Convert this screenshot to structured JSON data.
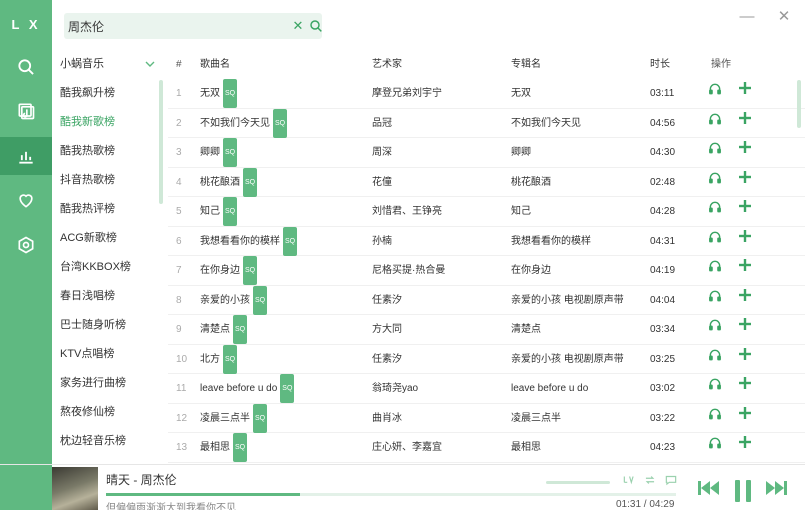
{
  "app": {
    "logo": "L X"
  },
  "search": {
    "value": "周杰伦",
    "clear_glyph": "✕"
  },
  "window": {
    "minimize": "—",
    "close": "✕"
  },
  "sources": {
    "selected": "小蜗音乐",
    "items": [
      {
        "label": "酷我飙升榜",
        "active": false
      },
      {
        "label": "酷我新歌榜",
        "active": true
      },
      {
        "label": "酷我热歌榜",
        "active": false
      },
      {
        "label": "抖音热歌榜",
        "active": false
      },
      {
        "label": "酷我热评榜",
        "active": false
      },
      {
        "label": "ACG新歌榜",
        "active": false
      },
      {
        "label": "台湾KKBOX榜",
        "active": false
      },
      {
        "label": "春日浅唱榜",
        "active": false
      },
      {
        "label": "巴士随身听榜",
        "active": false
      },
      {
        "label": "KTV点唱榜",
        "active": false
      },
      {
        "label": "家务进行曲榜",
        "active": false
      },
      {
        "label": "熬夜修仙榜",
        "active": false
      },
      {
        "label": "枕边轻音乐榜",
        "active": false
      }
    ]
  },
  "table": {
    "headers": {
      "num": "#",
      "title": "歌曲名",
      "artist": "艺术家",
      "album": "专辑名",
      "duration": "时长",
      "ops": "操作"
    },
    "quality_badge": "SQ",
    "rows": [
      {
        "num": "1",
        "title": "无双",
        "artist": "摩登兄弟刘宇宁",
        "album": "无双",
        "duration": "03:11"
      },
      {
        "num": "2",
        "title": "不如我们今天见",
        "artist": "品冠",
        "album": "不如我们今天见",
        "duration": "04:56"
      },
      {
        "num": "3",
        "title": "卿卿",
        "artist": "周深",
        "album": "卿卿",
        "duration": "04:30"
      },
      {
        "num": "4",
        "title": "桃花酿酒",
        "artist": "花僮",
        "album": "桃花酿酒",
        "duration": "02:48"
      },
      {
        "num": "5",
        "title": "知己",
        "artist": "刘惜君、王铮亮",
        "album": "知己",
        "duration": "04:28"
      },
      {
        "num": "6",
        "title": "我想看看你的模样",
        "artist": "孙楠",
        "album": "我想看看你的模样",
        "duration": "04:31"
      },
      {
        "num": "7",
        "title": "在你身边",
        "artist": "尼格买提·热合曼",
        "album": "在你身边",
        "duration": "04:19"
      },
      {
        "num": "8",
        "title": "亲爱的小孩",
        "artist": "任素汐",
        "album": "亲爱的小孩 电视剧原声带",
        "duration": "04:04"
      },
      {
        "num": "9",
        "title": "清楚点",
        "artist": "方大同",
        "album": "清楚点",
        "duration": "03:34"
      },
      {
        "num": "10",
        "title": "北方",
        "artist": "任素汐",
        "album": "亲爱的小孩 电视剧原声带",
        "duration": "03:25"
      },
      {
        "num": "11",
        "title": "leave before u do",
        "artist": "翁琦尧yao",
        "album": "leave before u do",
        "duration": "03:02"
      },
      {
        "num": "12",
        "title": "凌晨三点半",
        "artist": "曲肖冰",
        "album": "凌晨三点半",
        "duration": "03:22"
      },
      {
        "num": "13",
        "title": "最相思",
        "artist": "庄心妍、李嘉宜",
        "album": "最相思",
        "duration": "04:23"
      }
    ]
  },
  "player": {
    "title": "晴天 - 周杰伦",
    "lyric": "但偏偏雨渐渐大到我看你不见",
    "current_time": "01:31",
    "total_time": "04:29",
    "time_display": "01:31 / 04:29",
    "progress": 0.34,
    "volume": 0.7
  },
  "colors": {
    "accent": "#5fb981",
    "accent_dark": "#3f9d65",
    "accent_text": "#3aa463",
    "badge": "#5fb981"
  }
}
